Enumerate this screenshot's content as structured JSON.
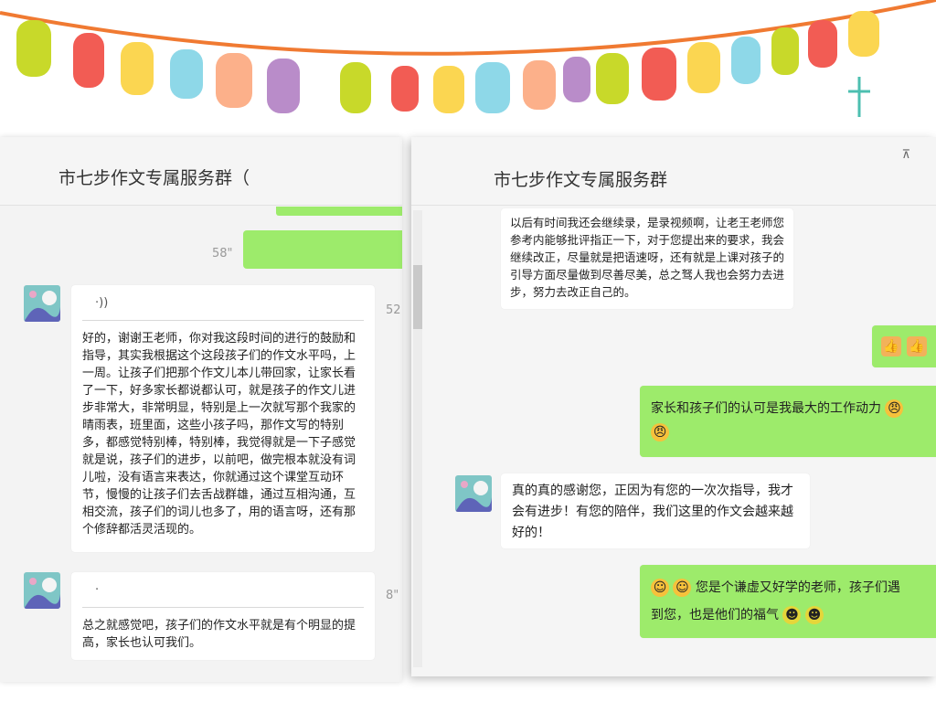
{
  "left_window": {
    "title": "市七步作文专属服务群（",
    "duration_1": "58\"",
    "duration_2": "52",
    "duration_3": "8\"",
    "message_1": "好的，谢谢王老师，你对我这段时间的进行的鼓励和指导，其实我根据这个这段孩子们的作文水平吗，上一周。让孩子们把那个作文儿本儿带回家，让家长看了一下，好多家长都说都认可，就是孩子的作文儿进步非常大，非常明显，特别是上一次就写那个我家的晴雨表，班里面，这些小孩子吗，那作文写的特别多，都感觉特别棒，特别棒，我觉得就是一下子感觉就是说，孩子们的进步，以前吧，做完根本就没有词儿啦，没有语言来表达，你就通过这个课堂互动环节，慢慢的让孩子们去舌战群雄，通过互相沟通，互相交流，孩子们的词儿也多了，用的语言呀，还有那个修辞都活灵活现的。",
    "message_2": "总之就感觉吧，孩子们的作文水平就是有个明显的提高，家长也认可我们。"
  },
  "right_window": {
    "title": "市七步作文专属服务群",
    "pin_label": "⊼",
    "message_1": "以后有时间我还会继续录，是录视频啊，让老王老师您参考内能够批评指正一下，对于您提出来的要求，我会继续改正，尽量就是把语速呀，还有就是上课对孩子的引导方面尽量做到尽善尽美，总之驽人我也会努力去进步，努力去改正自己的。",
    "message_2": "家长和孩子们的认可是我最大的工作动力",
    "message_3": "真的真的感谢您，正因为有您的一次次指导，我才会有进步！有您的陪伴，我们这里的作文会越来越好的！",
    "message_4_line1": "您是个谦虚又好学的老师，孩子们遇",
    "message_4_line2": "到您，也是他们的福气"
  },
  "icons": [
    "voice-wave-icon",
    "thumbs-up-icon",
    "smile-icon",
    "grin-icon",
    "strong-icon",
    "pin-icon",
    "avatar-image"
  ],
  "colors": {
    "green_bubble": "#9deb6b",
    "bunting_string": "#f07a32",
    "flags": [
      "#c8d92a",
      "#f25c54",
      "#fbd651",
      "#8ed8e8",
      "#fcb08a",
      "#b98cc9"
    ]
  }
}
